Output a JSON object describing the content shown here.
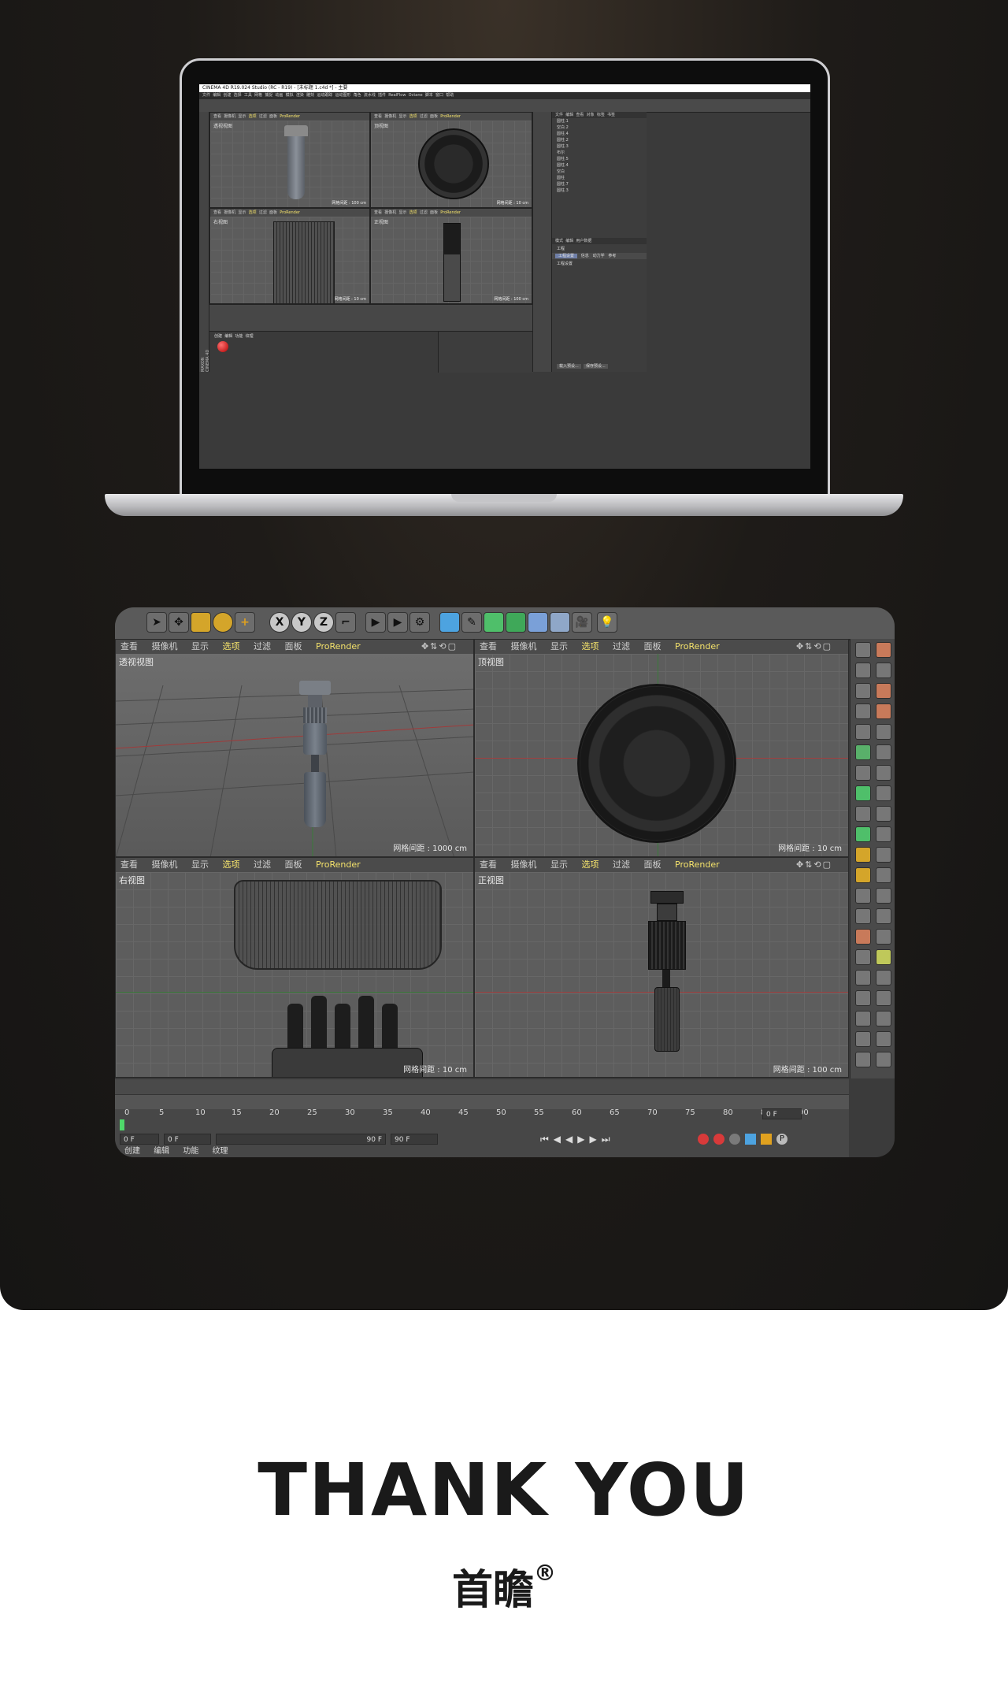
{
  "laptop_app": {
    "title": "CINEMA 4D R19.024 Studio (RC - R19) - [未标题 1.c4d *] - 主要",
    "menu": [
      "文件",
      "编辑",
      "创建",
      "选择",
      "工具",
      "网格",
      "捕捉",
      "动画",
      "模拟",
      "渲染",
      "雕刻",
      "运动跟踪",
      "运动图形",
      "角色",
      "流水线",
      "插件",
      "RealFlow",
      "Octane",
      "脚本",
      "窗口",
      "帮助"
    ],
    "viewports": {
      "persp_name": "透视视图",
      "top_name": "顶视图",
      "right_name": "右视图",
      "front_name": "正视图",
      "head_items": [
        "查看",
        "摄像机",
        "显示",
        "选项",
        "过滤",
        "面板"
      ],
      "head_renderer": "ProRender",
      "scale_persp": "网格间距 : 100 cm",
      "scale_top": "网格间距 : 10 cm",
      "scale_right": "网格间距 : 10 cm",
      "scale_front": "网格间距 : 100 cm"
    },
    "object_manager_tabs": [
      "文件",
      "编辑",
      "查看",
      "对象",
      "标签",
      "书签"
    ],
    "objects": [
      "圆柱.1",
      "空白.2",
      "圆柱.4",
      "圆柱.2",
      "圆柱.3",
      "布尔",
      "圆柱.5",
      "圆柱.4",
      "空白",
      "圆柱",
      "圆柱.7",
      "圆柱.3"
    ],
    "attr_tabs": [
      "模式",
      "编辑",
      "用户数据"
    ],
    "attr_title": "工程",
    "attr_subtabs": [
      "工程设置",
      "信息",
      "动力学",
      "参考"
    ],
    "attr_section": "工程设置",
    "attr_buttons": [
      "载入预设...",
      "保存预设..."
    ],
    "bottom_tabs": [
      "创建",
      "编辑",
      "功能",
      "纹理"
    ],
    "side_label": "MAXON CINEMA 4D"
  },
  "main_app": {
    "viewport_head": {
      "items": [
        "查看",
        "摄像机",
        "显示",
        "选项",
        "过滤",
        "面板"
      ],
      "selected": "选项",
      "renderer": "ProRender"
    },
    "viewports": [
      {
        "name": "透视视图",
        "scale": "网格间距 : 1000 cm"
      },
      {
        "name": "顶视图",
        "scale": "网格间距 : 10 cm"
      },
      {
        "name": "右视图",
        "scale": "网格间距 : 10 cm"
      },
      {
        "name": "正视图",
        "scale": "网格间距 : 100 cm"
      }
    ],
    "toolbar_axes": [
      "X",
      "Y",
      "Z"
    ],
    "timeline": {
      "ruler": [
        "0",
        "5",
        "10",
        "15",
        "20",
        "25",
        "30",
        "35",
        "40",
        "45",
        "50",
        "55",
        "60",
        "65",
        "70",
        "75",
        "80",
        "85",
        "90"
      ],
      "current_frame": "0 F",
      "start_frame": "0 F",
      "end_frame": "90 F",
      "end_frame_2": "90 F",
      "end_marker": "0 F"
    },
    "bottom_tabs": [
      "创建",
      "编辑",
      "功能",
      "纹理"
    ]
  },
  "footer": {
    "thanks": "THANK YOU",
    "brand": "首瞻",
    "trademark": "®"
  },
  "colors": {
    "hero_bg": "#161514",
    "viewport_bg": "#5d5d5d",
    "accent_yellow": "#f4e26b",
    "text_dark": "#1a1a1a"
  }
}
